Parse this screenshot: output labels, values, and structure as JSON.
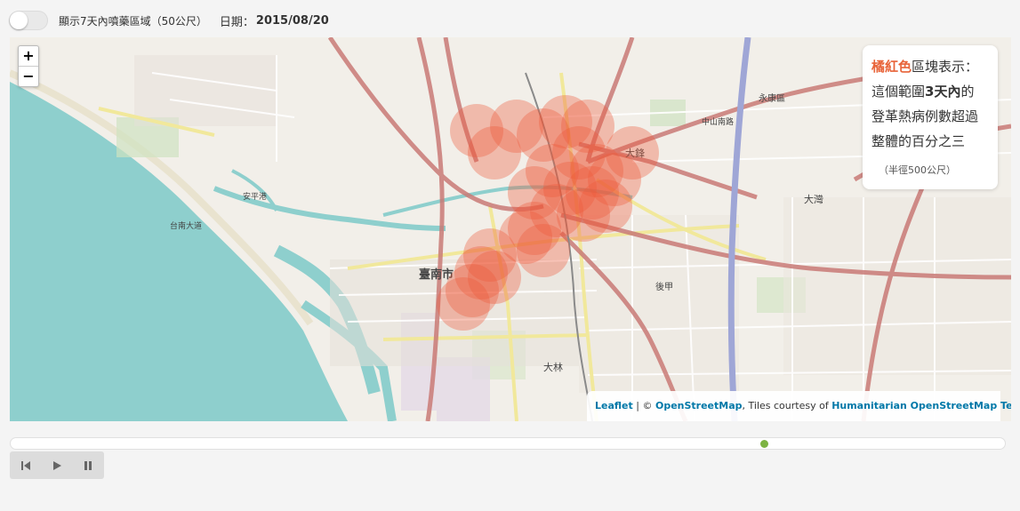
{
  "toggle": {
    "label": "顯示7天內噴藥區域（50公尺）",
    "state": "off"
  },
  "date": {
    "label": "日期：",
    "value": "2015/08/20"
  },
  "zoom": {
    "in_label": "+",
    "out_label": "−"
  },
  "legend": {
    "accent_text": "橘紅色",
    "line1_rest": "區塊表示：",
    "line2_pre": "這個範圍",
    "line2_bold": "3天內",
    "line2_post": "的",
    "line3": "登革熱病例數超過",
    "line4": "整體的百分之三",
    "note": "（半徑500公尺）",
    "accent_color": "#e8643a"
  },
  "attribution": {
    "leaflet": "Leaflet",
    "sep": " | © ",
    "osm": "OpenStreetMap",
    "tiles_text": ", Tiles courtesy of ",
    "hot": "Humanitarian OpenStreetMap Team"
  },
  "map_labels": {
    "tainan_city": "臺南市",
    "dafeng": "大鋒",
    "dawan": "大灣",
    "yongkang": "永康區",
    "houjia": "後甲",
    "dalin": "大林",
    "anping_harbor": "安平港",
    "zhongshan_rd": "中山南路",
    "tainan_ave": "台南大道"
  },
  "timeline": {
    "thumb_color": "#7cb342"
  },
  "playback": {
    "icons": [
      "skip-back-icon",
      "play-icon",
      "pause-icon"
    ]
  }
}
